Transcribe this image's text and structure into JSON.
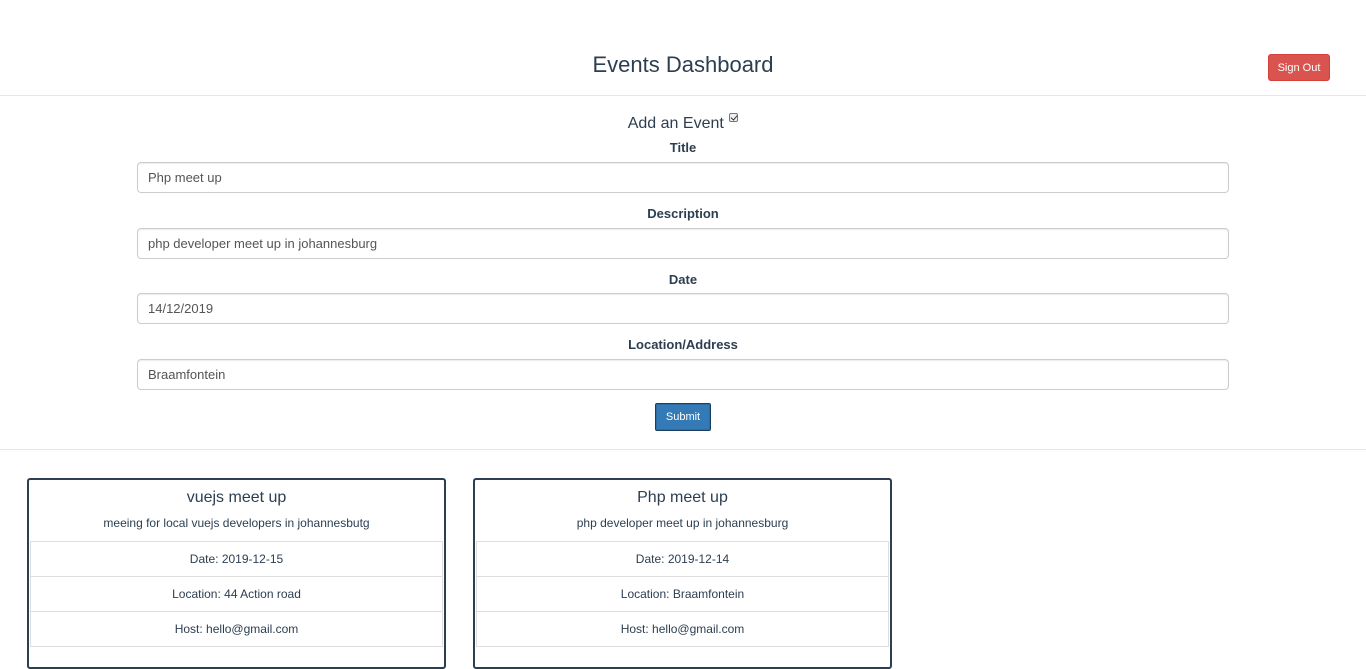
{
  "header": {
    "title": "Events Dashboard",
    "signout_label": "Sign Out"
  },
  "form": {
    "heading": "Add an Event",
    "checkbox_checked": true,
    "fields": [
      {
        "label": "Title",
        "value": "Php meet up"
      },
      {
        "label": "Description",
        "value": "php developer meet up in johannesburg"
      },
      {
        "label": "Date",
        "value": "14/12/2019"
      },
      {
        "label": "Location/Address",
        "value": "Braamfontein"
      }
    ],
    "submit_label": "Submit"
  },
  "events": [
    {
      "title": "vuejs meet up",
      "description": "meeing for local vuejs developers in johannesbutg",
      "date": "Date: 2019-12-15",
      "location": "Location: 44 Action road",
      "host": "Host: hello@gmail.com"
    },
    {
      "title": "Php meet up",
      "description": "php developer meet up in johannesburg",
      "date": "Date: 2019-12-14",
      "location": "Location: Braamfontein",
      "host": "Host: hello@gmail.com"
    }
  ],
  "colors": {
    "signout": "#d9534f",
    "submit": "#337ab7",
    "text": "#2c3e50"
  }
}
